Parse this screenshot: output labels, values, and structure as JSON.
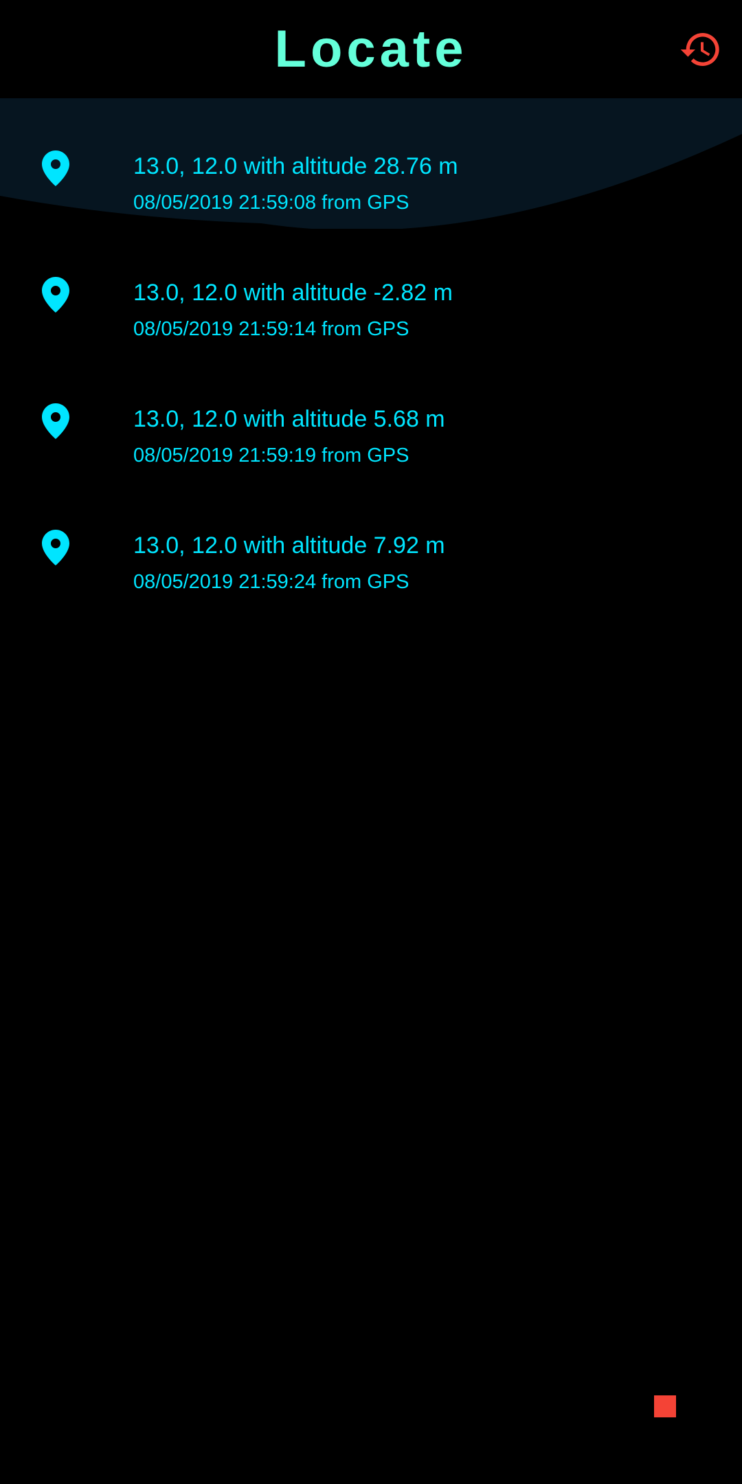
{
  "colors": {
    "background": "#000000",
    "title": "#64FFDA",
    "accent": "#00E5FF",
    "history_icon": "#F44336",
    "stop": "#F44336",
    "wave": "#061520"
  },
  "header": {
    "title": "Locate",
    "history_icon": "history-icon"
  },
  "locations": [
    {
      "icon": "location-pin-icon",
      "position": "13.0, 12.0 with altitude 28.76 m",
      "details": "08/05/2019 21:59:08 from GPS"
    },
    {
      "icon": "location-pin-icon",
      "position": "13.0, 12.0 with altitude -2.82 m",
      "details": "08/05/2019 21:59:14 from GPS"
    },
    {
      "icon": "location-pin-icon",
      "position": "13.0, 12.0 with altitude 5.68 m",
      "details": "08/05/2019 21:59:19 from GPS"
    },
    {
      "icon": "location-pin-icon",
      "position": "13.0, 12.0 with altitude 7.92 m",
      "details": "08/05/2019 21:59:24 from GPS"
    }
  ],
  "stop_button": {
    "icon": "stop-icon"
  }
}
